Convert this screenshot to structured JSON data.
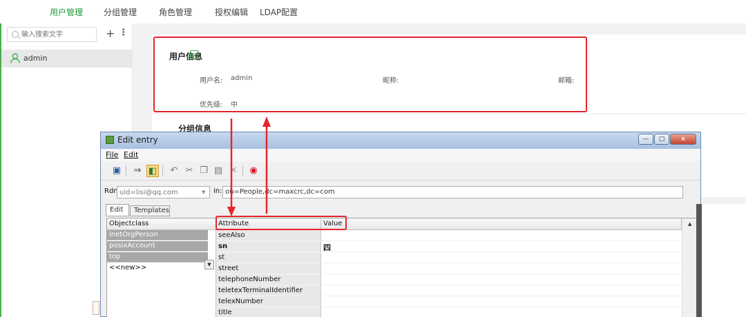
{
  "nav": {
    "tabs": [
      "用户管理",
      "分组管理",
      "角色管理",
      "授权编辑",
      "LDAP配置"
    ],
    "active_index": 0
  },
  "sidebar": {
    "search_placeholder": "输入搜索文字",
    "add_label": "+",
    "more_label": "⋮",
    "users": [
      "admin"
    ]
  },
  "user_info": {
    "title": "用户信息",
    "username_label": "用户名:",
    "username_value": "admin",
    "nickname_label": "昵称:",
    "email_label": "邮箱:",
    "priority_label": "优先级:",
    "priority_value": "中"
  },
  "group_info": {
    "title": "分组信息"
  },
  "edit_window": {
    "title": "Edit entry",
    "menu": [
      "File",
      "Edit"
    ],
    "rdn_label": "Rdn:",
    "rdn_value": "uid=lisi@qq.com",
    "in_label": "in:",
    "in_value": "ou=People,dc=maxcrc,dc=com",
    "tabs": [
      "Edit",
      "Templates"
    ],
    "objectclass_header": "Objectclass",
    "objectclasses": [
      "inetOrgPerson",
      "posixAccount",
      "top"
    ],
    "new_objectclass": "<<new>>",
    "attribute_header": "Attribute",
    "value_header": "Value",
    "attributes": [
      {
        "name": "seeAlso",
        "value": "",
        "bold": false
      },
      {
        "name": "sn",
        "value": "四",
        "bold": true
      },
      {
        "name": "st",
        "value": "",
        "bold": false
      },
      {
        "name": "street",
        "value": "",
        "bold": false
      },
      {
        "name": "telephoneNumber",
        "value": "",
        "bold": false
      },
      {
        "name": "teletexTerminalIdentifier",
        "value": "",
        "bold": false
      },
      {
        "name": "telexNumber",
        "value": "",
        "bold": false
      },
      {
        "name": "title",
        "value": "",
        "bold": false
      }
    ]
  },
  "colors": {
    "accent_green": "#1f9c3c",
    "highlight_red": "#e8242b"
  }
}
